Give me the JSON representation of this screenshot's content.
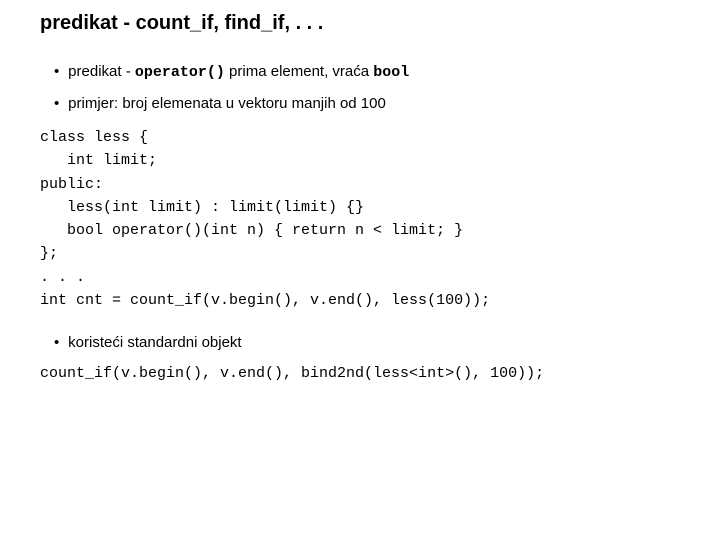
{
  "title": "predikat - count_if, find_if, . . .",
  "bullets": {
    "b1_pre": "predikat - ",
    "b1_mono": "operator()",
    "b1_mid": " prima element, vraća ",
    "b1_mono2": "bool",
    "b2": "primjer: broj elemenata u vektoru manjih od 100",
    "b3": "koristeći standardni objekt"
  },
  "code1": "class less {\n   int limit;\npublic:\n   less(int limit) : limit(limit) {}\n   bool operator()(int n) { return n < limit; }\n};\n. . .\nint cnt = count_if(v.begin(), v.end(), less(100));",
  "code2": "count_if(v.begin(), v.end(), bind2nd(less<int>(), 100));"
}
